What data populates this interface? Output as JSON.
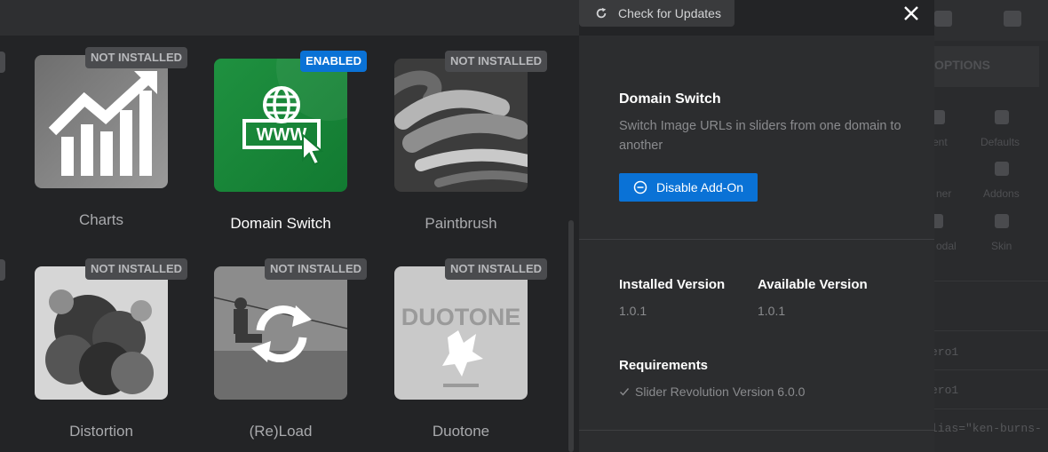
{
  "toolbar": {
    "check_updates_label": "Check for Updates"
  },
  "addons": [
    {
      "name": "Charts",
      "status": "NOT INSTALLED",
      "active": false
    },
    {
      "name": "Domain Switch",
      "status": "ENABLED",
      "active": true
    },
    {
      "name": "Paintbrush",
      "status": "NOT INSTALLED",
      "active": false
    },
    {
      "name": "Distortion",
      "status": "NOT INSTALLED",
      "active": false
    },
    {
      "name": "(Re)Load",
      "status": "NOT INSTALLED",
      "active": false
    },
    {
      "name": "Duotone",
      "status": "NOT INSTALLED",
      "active": false
    }
  ],
  "thumbnails": {
    "duotone_logo_text": "DUOTONE"
  },
  "detail": {
    "title": "Domain Switch",
    "description": "Switch Image URLs in sliders from one domain to another",
    "disable_label": "Disable Add-On",
    "installed_version_label": "Installed Version",
    "installed_version": "1.0.1",
    "available_version_label": "Available Version",
    "available_version": "1.0.1",
    "requirements_label": "Requirements",
    "requirements": [
      "Slider Revolution Version 6.0.0"
    ]
  },
  "background": {
    "options_title": "OPTIONS",
    "labels": [
      "ent",
      "Defaults",
      "ner",
      "Addons",
      "odal",
      "Skin"
    ],
    "rows": [
      "ero1",
      "ero1",
      "lias=\"ken-burns-"
    ]
  },
  "colors": {
    "accent": "#0a72d6",
    "enabled_thumb": "#1a8a3a",
    "panel": "#2c2d2f",
    "background": "#232426"
  },
  "icons": {
    "refresh": "refresh-icon",
    "close": "close-icon",
    "disable": "minus-circle-icon",
    "check": "check-icon"
  }
}
